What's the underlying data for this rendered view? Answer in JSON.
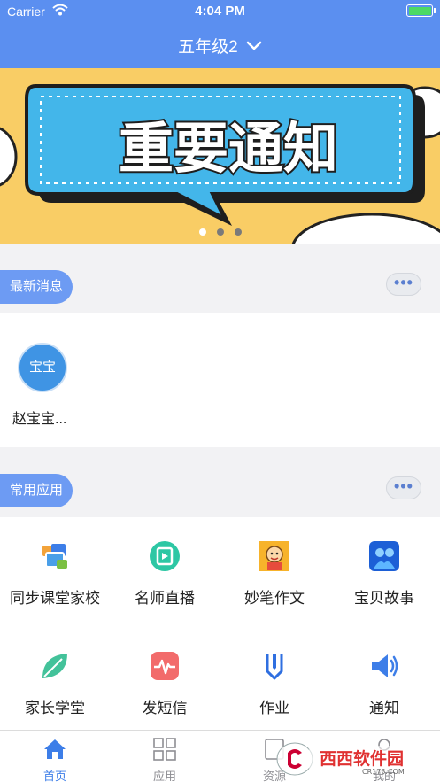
{
  "status_bar": {
    "carrier": "Carrier",
    "time": "4:04 PM"
  },
  "header": {
    "class_title": "五年级2"
  },
  "banner": {
    "text": "重要通知",
    "dot_count": 3,
    "active_dot": 0
  },
  "messages_section": {
    "title": "最新消息",
    "more": "•••"
  },
  "contacts": [
    {
      "avatar_text": "宝宝",
      "name": "赵宝宝..."
    }
  ],
  "apps_section": {
    "title": "常用应用",
    "more": "•••"
  },
  "apps": [
    {
      "label": "同步课堂家校",
      "icon": "classroom-icon"
    },
    {
      "label": "名师直播",
      "icon": "live-video-icon"
    },
    {
      "label": "妙笔作文",
      "icon": "cartoon-writer-icon"
    },
    {
      "label": "宝贝故事",
      "icon": "story-icon"
    },
    {
      "label": "家长学堂",
      "icon": "leaf-icon"
    },
    {
      "label": "发短信",
      "icon": "message-pulse-icon"
    },
    {
      "label": "作业",
      "icon": "homework-icon"
    },
    {
      "label": "通知",
      "icon": "speaker-icon"
    }
  ],
  "tabs": [
    {
      "label": "首页",
      "icon": "home-icon",
      "active": true
    },
    {
      "label": "应用",
      "icon": "grid-icon",
      "active": false
    },
    {
      "label": "资源",
      "icon": "resource-icon",
      "active": false
    },
    {
      "label": "我的",
      "icon": "profile-icon",
      "active": false
    }
  ],
  "watermark": {
    "brand": "西西软件园",
    "url": "CR173.COM"
  },
  "colors": {
    "header": "#5b8ff0",
    "banner": "#f9cd65",
    "accent": "#3d7ee8",
    "pill": "#6d9bf3"
  }
}
